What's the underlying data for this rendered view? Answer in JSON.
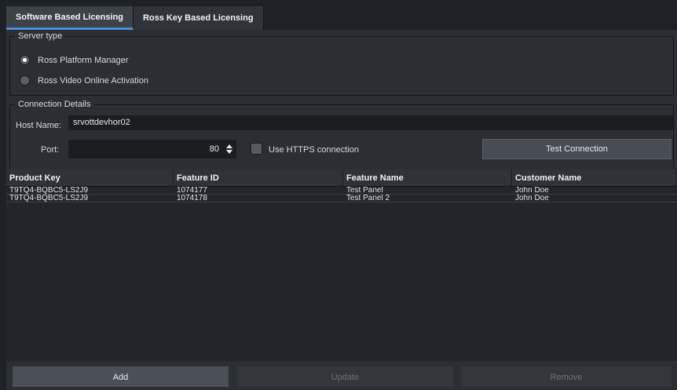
{
  "tabs": [
    {
      "label": "Software Based Licensing"
    },
    {
      "label": "Ross Key Based Licensing"
    }
  ],
  "server_type": {
    "title": "Server type",
    "options": [
      {
        "label": "Ross Platform Manager",
        "selected": true
      },
      {
        "label": "Ross Video Online Activation",
        "selected": false
      }
    ]
  },
  "connection": {
    "title": "Connection Details",
    "host_label": "Host Name:",
    "host_value": "srvottdevhor02",
    "port_label": "Port:",
    "port_value": "80",
    "https_label": "Use HTTPS connection",
    "https_checked": false,
    "test_button": "Test Connection"
  },
  "table": {
    "columns": [
      "Product Key",
      "Feature ID",
      "Feature Name",
      "Customer Name"
    ],
    "rows": [
      [
        "T9TQ4-BQBC5-LS2J9",
        "1074177",
        "Test Panel",
        "John Doe"
      ],
      [
        "T9TQ4-BQBC5-LS2J9",
        "1074178",
        "Test Panel 2",
        "John Doe"
      ]
    ]
  },
  "footer": {
    "add": "Add",
    "update": "Update",
    "remove": "Remove"
  },
  "colors": {
    "accent": "#4a90d9",
    "background": "#2b2e33"
  }
}
